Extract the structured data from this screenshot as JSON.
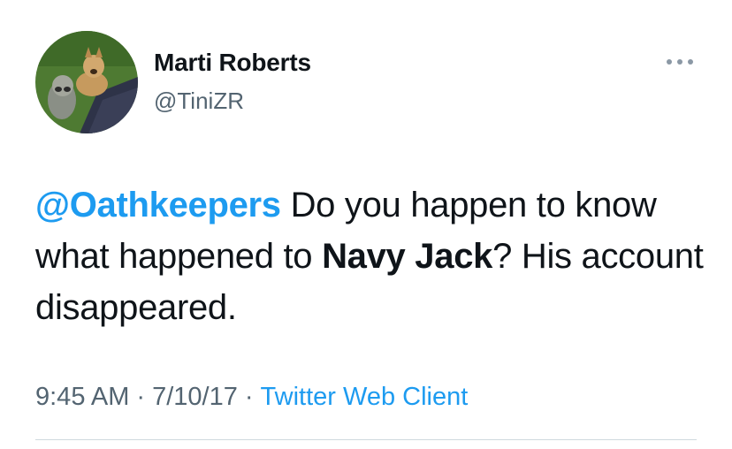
{
  "user": {
    "display_name": "Marti Roberts",
    "handle": "@TiniZR"
  },
  "tweet": {
    "mention": "@Oathkeepers",
    "text_part1": " Do you happen to know what happened to ",
    "bold_name": "Navy Jack",
    "text_part2": "? His account disappeared."
  },
  "meta": {
    "time": "9:45 AM",
    "date": "7/10/17",
    "separator": "·",
    "client": "Twitter Web Client"
  },
  "icons": {
    "more": "more-dots-icon",
    "avatar": "avatar-dogs-photo"
  },
  "colors": {
    "accent": "#1d9bf0",
    "text": "#0f1419",
    "secondary": "#536471",
    "divider": "#cfd9de"
  }
}
